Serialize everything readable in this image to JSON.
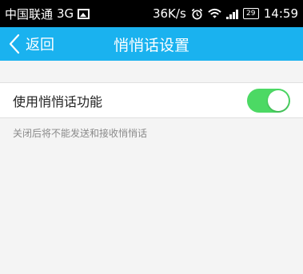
{
  "status_bar": {
    "carrier": "中国联通",
    "network": "3G",
    "speed": "36K/s",
    "alarm_icon": "alarm-icon",
    "wifi_icon": "wifi-icon",
    "battery_level": "29",
    "time": "14:59"
  },
  "nav": {
    "back_label": "返回",
    "title": "悄悄话设置",
    "accent_color": "#1ab2ef"
  },
  "settings": {
    "whisper_label": "使用悄悄话功能",
    "whisper_enabled": true,
    "toggle_on_color": "#4cd964"
  },
  "hint_text": "关闭后将不能发送和接收悄悄话"
}
